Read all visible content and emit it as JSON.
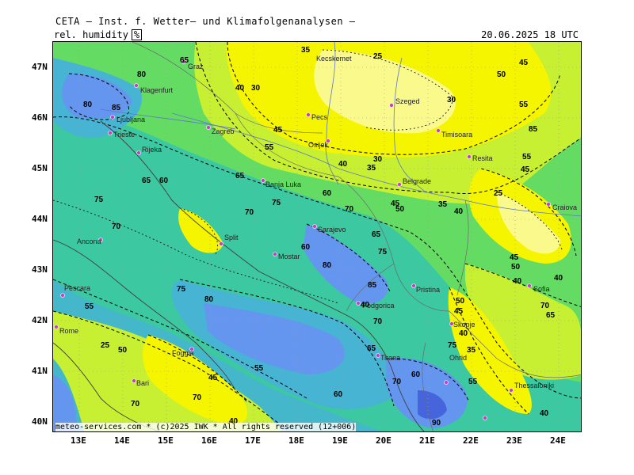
{
  "header": {
    "title": "CETA — Inst. f. Wetter— und Klimafolgenanalysen —",
    "parameter": "rel. humidity",
    "unit": "%",
    "valid_time": "20.06.2025  18 UTC"
  },
  "footer": {
    "credit": "meteo-services.com * (c)2025 IWK * All rights reserved (12+006)"
  },
  "axes": {
    "lat_labels": [
      "47N",
      "46N",
      "45N",
      "44N",
      "43N",
      "42N",
      "41N",
      "40N"
    ],
    "lon_labels": [
      "13E",
      "14E",
      "15E",
      "16E",
      "17E",
      "18E",
      "19E",
      "20E",
      "21E",
      "22E",
      "23E",
      "24E"
    ]
  },
  "colors": {
    "yellow": "#f5f500",
    "light_yellow": "#fafa8c",
    "yellow_green": "#c8f032",
    "green": "#64dc64",
    "teal": "#3cc8a0",
    "cyan": "#46b4d2",
    "blue": "#6496f0",
    "dark_blue": "#4664dc"
  },
  "cities": [
    "Graz",
    "Klagenfurt",
    "Ljubljana",
    "Zagreb",
    "Trieste",
    "Rijeka",
    "Szeged",
    "Pecs",
    "Osijek",
    "Timisoara",
    "Resita",
    "Banja Luka",
    "Belgrade",
    "Craiova",
    "Sarajevo",
    "Split",
    "Mostar",
    "Ancona",
    "Pescara",
    "Rome",
    "Foggia",
    "Bari",
    "Podgorica",
    "Pristina",
    "Skopje",
    "Sofia",
    "Tirana",
    "Ohrid",
    "Thessaloniki",
    "Kecskemet"
  ],
  "contour_labels": [
    "35",
    "25",
    "45",
    "50",
    "55",
    "40",
    "30",
    "30",
    "45",
    "40",
    "30",
    "35",
    "55",
    "60",
    "65",
    "70",
    "75",
    "80",
    "85",
    "90",
    "65",
    "70",
    "75",
    "80",
    "85",
    "80",
    "75",
    "70",
    "65",
    "60",
    "55",
    "50",
    "45",
    "40",
    "35",
    "45",
    "50",
    "55",
    "60",
    "40",
    "25",
    "45",
    "50",
    "55",
    "40",
    "70",
    "75",
    "80",
    "85",
    "90",
    "50",
    "45",
    "40",
    "35",
    "55",
    "60",
    "65",
    "70",
    "80",
    "85",
    "75"
  ]
}
